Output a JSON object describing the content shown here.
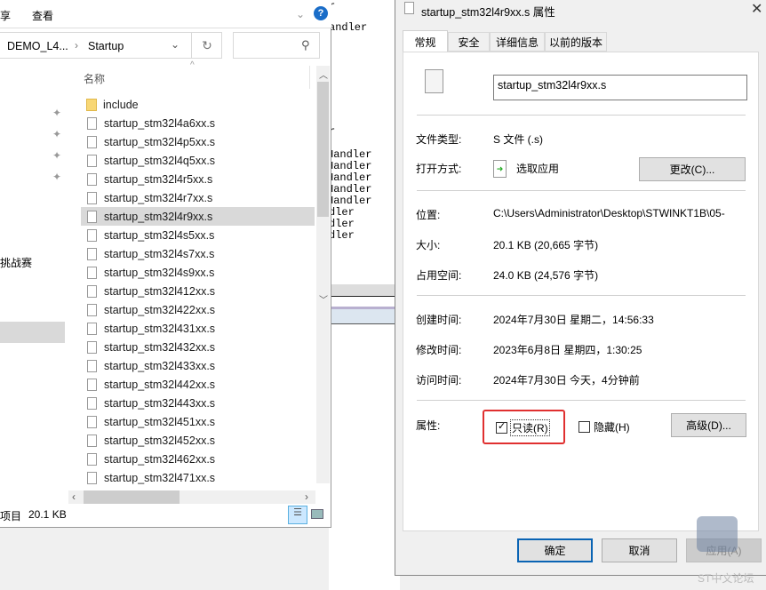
{
  "background_code": [
    "r",
    "andler",
    "r",
    "Handler",
    "Handler",
    "Handler",
    "Handler",
    "Handler",
    "dler",
    "dler",
    "dler"
  ],
  "explorer": {
    "ribbon": {
      "share_tab": "享",
      "view_tab": "查看"
    },
    "address": {
      "parent": "DEMO_L4...",
      "current": "Startup"
    },
    "column_header": "名称",
    "sidebar_partial_text": "挑战赛",
    "files": [
      "include",
      "startup_stm32l4a6xx.s",
      "startup_stm32l4p5xx.s",
      "startup_stm32l4q5xx.s",
      "startup_stm32l4r5xx.s",
      "startup_stm32l4r7xx.s",
      "startup_stm32l4r9xx.s",
      "startup_stm32l4s5xx.s",
      "startup_stm32l4s7xx.s",
      "startup_stm32l4s9xx.s",
      "startup_stm32l412xx.s",
      "startup_stm32l422xx.s",
      "startup_stm32l431xx.s",
      "startup_stm32l432xx.s",
      "startup_stm32l433xx.s",
      "startup_stm32l442xx.s",
      "startup_stm32l443xx.s",
      "startup_stm32l451xx.s",
      "startup_stm32l452xx.s",
      "startup_stm32l462xx.s",
      "startup_stm32l471xx.s"
    ],
    "selected_file": "startup_stm32l4r9xx.s",
    "status": {
      "items": "项目",
      "size": "20.1 KB"
    }
  },
  "dialog": {
    "title": "startup_stm32l4r9xx.s 属性",
    "tabs": [
      "常规",
      "安全",
      "详细信息",
      "以前的版本"
    ],
    "filename": "startup_stm32l4r9xx.s",
    "file_type_label": "文件类型:",
    "file_type": "S 文件 (.s)",
    "open_with_label": "打开方式:",
    "open_with": "选取应用",
    "change_button": "更改(C)...",
    "location_label": "位置:",
    "location": "C:\\Users\\Administrator\\Desktop\\STWINKT1B\\05-",
    "size_label": "大小:",
    "size": "20.1 KB (20,665 字节)",
    "disk_size_label": "占用空间:",
    "disk_size": "24.0 KB (24,576 字节)",
    "created_label": "创建时间:",
    "created": "2024年7月30日 星期二，14:56:33",
    "modified_label": "修改时间:",
    "modified": "2023年6月8日 星期四，1:30:25",
    "accessed_label": "访问时间:",
    "accessed": "2024年7月30日 今天，4分钟前",
    "attributes_label": "属性:",
    "readonly_label": "只读(R)",
    "readonly_checked": true,
    "hidden_label": "隐藏(H)",
    "hidden_checked": false,
    "advanced_button": "高级(D)...",
    "ok_button": "确定",
    "cancel_button": "取消",
    "apply_button": "应用(A)",
    "highlight_color": "#e03030"
  },
  "watermark": "ST中文论坛"
}
